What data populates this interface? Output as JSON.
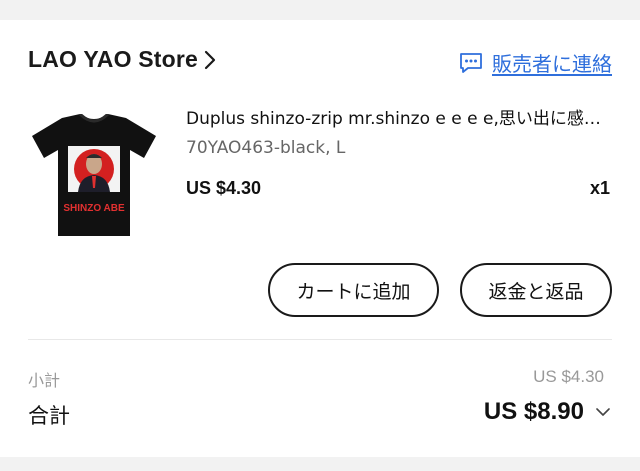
{
  "store": {
    "name": "LAO YAO Store",
    "contact_label": "販売者に連絡"
  },
  "product": {
    "title": "Duplus shinzo-zrip mr.shinzo e e e e,思い出に感謝 Tシャツ",
    "variant": "70YAO463-black, L",
    "price": "US $4.30",
    "quantity": "x1",
    "shirt_text": "SHINZO ABE"
  },
  "actions": {
    "add_to_cart": "カートに追加",
    "refund_return": "返金と返品"
  },
  "summary": {
    "subtotal_label": "小計",
    "subtotal_value": "US $4.30",
    "total_label": "合計",
    "total_value": "US $8.90"
  },
  "colors": {
    "accent_link": "#2f6fdc",
    "shirt": "#111111",
    "flag_red": "#d32020"
  },
  "icons": {
    "store_chevron": "chevron-right-icon",
    "contact": "chat-bubble-icon",
    "total_chevron": "chevron-down-icon"
  }
}
